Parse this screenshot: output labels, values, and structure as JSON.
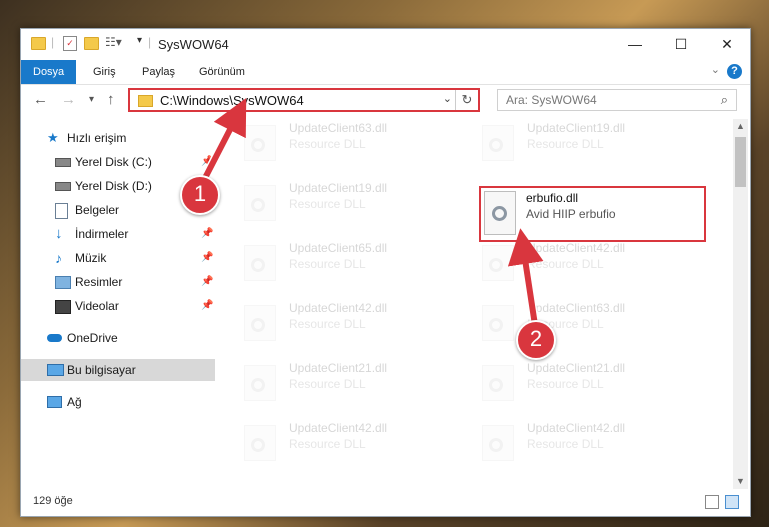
{
  "window": {
    "title": "SysWOW64",
    "controls": {
      "minimize": "—",
      "maximize": "☐",
      "close": "✕"
    }
  },
  "ribbon": {
    "tabs": [
      "Dosya",
      "Giriş",
      "Paylaş",
      "Görünüm"
    ],
    "help": "?"
  },
  "address": {
    "path": "C:\\Windows\\SysWOW64",
    "search_placeholder": "Ara: SysWOW64"
  },
  "nav": {
    "items": [
      {
        "label": "Hızlı erişim",
        "icon": "star-icon"
      },
      {
        "label": "Yerel Disk (C:)",
        "icon": "drive-icon",
        "pinned": true
      },
      {
        "label": "Yerel Disk (D:)",
        "icon": "drive-icon",
        "pinned": true
      },
      {
        "label": "Belgeler",
        "icon": "document-icon",
        "pinned": true
      },
      {
        "label": "İndirmeler",
        "icon": "download-icon",
        "pinned": true
      },
      {
        "label": "Müzik",
        "icon": "music-icon",
        "pinned": true
      },
      {
        "label": "Resimler",
        "icon": "pictures-icon",
        "pinned": true
      },
      {
        "label": "Videolar",
        "icon": "video-icon",
        "pinned": true
      },
      {
        "label": "OneDrive",
        "icon": "cloud-icon"
      },
      {
        "label": "Bu bilgisayar",
        "icon": "computer-icon",
        "selected": true
      },
      {
        "label": "Ağ",
        "icon": "network-icon"
      }
    ]
  },
  "files": {
    "left": [
      {
        "name": "UpdateClient63.dll",
        "desc": "Resource DLL"
      },
      {
        "name": "UpdateClient19.dll",
        "desc": "Resource DLL"
      },
      {
        "name": "UpdateClient65.dll",
        "desc": "Resource DLL"
      },
      {
        "name": "UpdateClient42.dll",
        "desc": "Resource DLL"
      },
      {
        "name": "UpdateClient21.dll",
        "desc": "Resource DLL"
      },
      {
        "name": "UpdateClient42.dll",
        "desc": "Resource DLL"
      }
    ],
    "right": [
      {
        "name": "UpdateClient19.dll",
        "desc": "Resource DLL"
      },
      {
        "name": "UpdateClient42.dll",
        "desc": "Resource DLL"
      },
      {
        "name": "UpdateClient63.dll",
        "desc": "Resource DLL"
      },
      {
        "name": "UpdateClient21.dll",
        "desc": "Resource DLL"
      },
      {
        "name": "UpdateClient42.dll",
        "desc": "Resource DLL"
      }
    ],
    "highlighted": {
      "name": "erbufio.dll",
      "desc": "Avid HIIP erbufio"
    }
  },
  "status": {
    "count": "129 öğe"
  },
  "annotations": {
    "step1": "1",
    "step2": "2"
  },
  "colors": {
    "accent": "#1979ca",
    "annotation": "#d9363e"
  }
}
